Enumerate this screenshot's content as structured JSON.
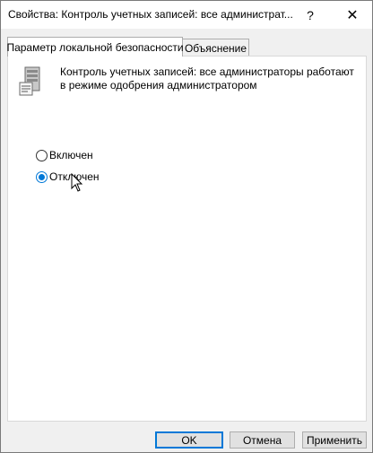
{
  "window": {
    "title": "Свойства: Контроль учетных записей: все администрат...",
    "help_glyph": "?",
    "close_glyph": "✕"
  },
  "tabs": [
    {
      "label": "Параметр локальной безопасности",
      "active": true
    },
    {
      "label": "Объяснение",
      "active": false
    }
  ],
  "policy": {
    "icon": "server-policy-icon",
    "description": "Контроль учетных записей: все администраторы работают в режиме одобрения администратором"
  },
  "options": [
    {
      "label": "Включен",
      "checked": false
    },
    {
      "label": "Отключен",
      "checked": true
    }
  ],
  "buttons": {
    "ok": "OK",
    "cancel": "Отмена",
    "apply": "Применить"
  },
  "colors": {
    "accent": "#0078d7",
    "window_bg": "#f0f0f0",
    "panel_bg": "#ffffff"
  }
}
